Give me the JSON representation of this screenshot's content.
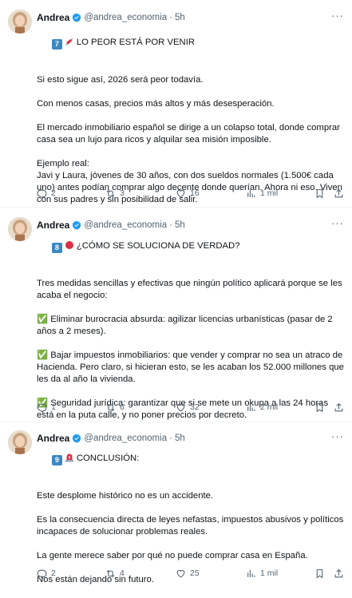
{
  "tweets": [
    {
      "author": "Andrea",
      "handle": "@andrea_economia",
      "time": "5h",
      "badge_num": "7",
      "title": "LO PEOR ESTÁ POR VENIR",
      "paragraphs": [
        "Si esto sigue así, 2026 será peor todavía.",
        "Con menos casas, precios más altos y más desesperación.",
        "El mercado inmobiliario español se dirige a un colapso total, donde comprar casa sea un lujo para ricos y alquilar sea misión imposible.",
        "Ejemplo real:\nJavi y Laura, jóvenes de 30 años, con dos sueldos normales (1.500€ cada uno) antes podían comprar algo decente donde querían. Ahora ni eso. Viven con sus padres y sin posibilidad de salir."
      ],
      "replies": "2",
      "retweets": "3",
      "likes": "16",
      "views": "1 mil"
    },
    {
      "author": "Andrea",
      "handle": "@andrea_economia",
      "time": "5h",
      "badge_num": "8",
      "title": "¿CÓMO SE SOLUCIONA DE VERDAD?",
      "paragraphs": [
        "Tres medidas sencillas y efectivas que ningún político aplicará porque se les acaba el negocio:",
        "✅ Eliminar burocracia absurda: agilizar licencias urbanísticas (pasar de 2 años a 2 meses).",
        "✅ Bajar impuestos inmobiliarios: que vender y comprar no sea un atraco de Hacienda. Pero claro, si hicieran esto, se les acaban los 52.000 millones que les da al año la vivienda.",
        "✅ Seguridad jurídica: garantizar que si se mete un okupa a las 24 horas está en la puta calle, y no poner precios por decreto."
      ],
      "replies": "1",
      "retweets": "6",
      "likes": "32",
      "views": "2 mil"
    },
    {
      "author": "Andrea",
      "handle": "@andrea_economia",
      "time": "5h",
      "badge_num": "9",
      "title": "CONCLUSIÓN:",
      "paragraphs": [
        "Este desplome histórico no es un accidente.",
        "Es la consecuencia directa de leyes nefastas, impuestos abusivos y políticos incapaces de solucionar problemas reales.",
        "La gente merece saber por qué no puede comprar casa en España.",
        "Nos están dejando sin futuro."
      ],
      "replies": "2",
      "retweets": "4",
      "likes": "25",
      "views": "1 mil"
    }
  ],
  "colors": {
    "text": "#0f1419",
    "secondary": "#536471",
    "verified": "#1d9bf0",
    "divider": "#eff3f4",
    "badge": "#3b88c3"
  },
  "icons": [
    "verified-badge-icon",
    "syringe-icon",
    "red-circle-icon",
    "siren-icon",
    "reply-icon",
    "retweet-icon",
    "like-icon",
    "views-icon",
    "bookmark-icon",
    "share-icon",
    "more-icon"
  ]
}
